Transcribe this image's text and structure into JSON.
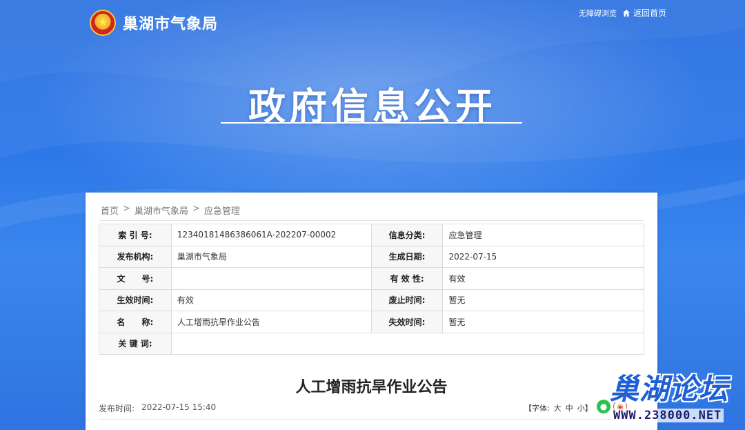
{
  "header": {
    "site_name": "巢湖市气象局",
    "accessibility": "无障碍浏览",
    "home_link": "返回首页",
    "banner_title": "政府信息公开"
  },
  "breadcrumb": [
    "首页",
    "巢湖市气象局",
    "应急管理"
  ],
  "breadcrumb_sep": ">",
  "meta": {
    "rows": [
      [
        {
          "k": "索 引 号:",
          "v": "12340181486386061A-202207-00002"
        },
        {
          "k": "信息分类:",
          "v": "应急管理"
        }
      ],
      [
        {
          "k": "发布机构:",
          "v": "巢湖市气象局"
        },
        {
          "k": "生成日期:",
          "v": "2022-07-15"
        }
      ],
      [
        {
          "k": "文　　号:",
          "v": ""
        },
        {
          "k": "有 效 性:",
          "v": "有效"
        }
      ],
      [
        {
          "k": "生效时间:",
          "v": "有效"
        },
        {
          "k": "废止时间:",
          "v": "暂无"
        }
      ],
      [
        {
          "k": "名　　称:",
          "v": "人工增雨抗旱作业公告"
        },
        {
          "k": "失效时间:",
          "v": "暂无"
        }
      ]
    ],
    "keywords_label": "关 键 词:",
    "keywords_value": ""
  },
  "article": {
    "title": "人工增雨抗旱作业公告",
    "pub_label": "发布时间:",
    "pub_time": "2022-07-15 15:40",
    "font_label": "【字体:",
    "font_large": "大",
    "font_medium": "中",
    "font_small": "小】"
  },
  "watermark": {
    "main": "巢湖论坛",
    "url": "WWW.238000.NET"
  },
  "colors": {
    "banner_blue": "#2f74e0",
    "wechat_green": "#2ec04b",
    "weibo_red": "#e3492e"
  }
}
